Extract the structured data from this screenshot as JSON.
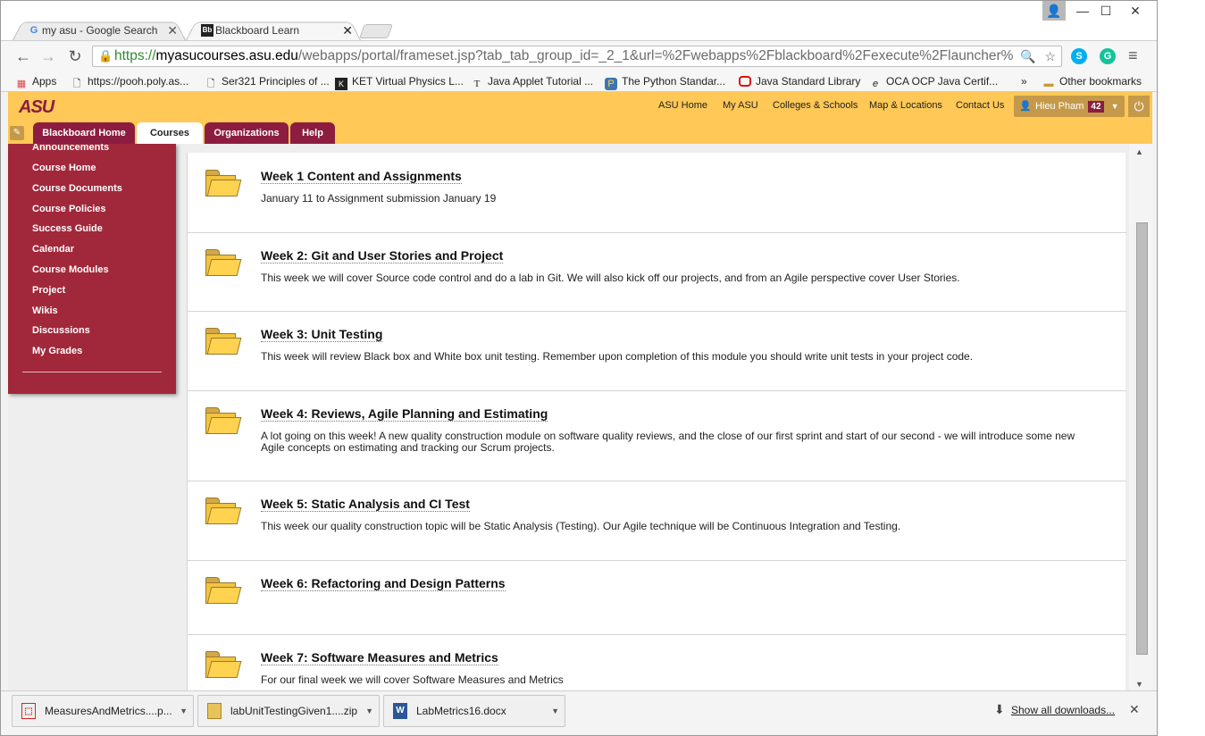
{
  "browser": {
    "tabs": [
      {
        "label": "my asu - Google Search",
        "favicon": "google-icon"
      },
      {
        "label": "Blackboard Learn",
        "favicon": "blackboard-icon"
      }
    ],
    "url_scheme": "https://",
    "url_host": "myasucourses.asu.edu",
    "url_path": "/webapps/portal/frameset.jsp?tab_tab_group_id=_2_1&url=%2Fwebapps%2Fblackboard%2Fexecute%2Flauncher%",
    "bookmarks": [
      {
        "label": "Apps",
        "icon": "apps-grid-icon"
      },
      {
        "label": "https://pooh.poly.as...",
        "icon": "page-icon"
      },
      {
        "label": "Ser321 Principles of ...",
        "icon": "page-icon"
      },
      {
        "label": "KET Virtual Physics L...",
        "icon": "ket-icon"
      },
      {
        "label": "Java Applet Tutorial ...",
        "icon": "text-t-icon"
      },
      {
        "label": "The Python Standar...",
        "icon": "python-icon"
      },
      {
        "label": "Java Standard Library",
        "icon": "oracle-icon"
      },
      {
        "label": "OCA OCP Java Certif...",
        "icon": "e-icon"
      }
    ],
    "other_bookmarks": "Other bookmarks",
    "overflow": "»"
  },
  "header": {
    "logo": "ASU",
    "top_links": [
      "ASU Home",
      "My ASU",
      "Colleges & Schools",
      "Map & Locations",
      "Contact Us"
    ],
    "user_name": "Hieu Pham",
    "notification_count": "42",
    "tabs": [
      "Blackboard Home",
      "Courses",
      "Organizations",
      "Help"
    ]
  },
  "course_menu": {
    "items": [
      "Announcements",
      "Course Home",
      "Course Documents",
      "Course Policies",
      "Success Guide",
      "Calendar",
      "Course Modules",
      "Project",
      "Wikis",
      "Discussions",
      "My Grades"
    ]
  },
  "content": {
    "items": [
      {
        "title": "Week 1 Content and Assignments",
        "description": "January 11 to Assignment submission January 19"
      },
      {
        "title": "Week 2: Git and User Stories and Project",
        "description": "This week we will cover Source code control and do a lab in Git. We will also kick off our projects, and from an Agile perspective cover User Stories."
      },
      {
        "title": "Week 3: Unit Testing",
        "description": "This week will review Black box and White box unit testing. Remember upon completion of this module you should write unit tests in your project code."
      },
      {
        "title": "Week 4: Reviews, Agile Planning and Estimating",
        "description": "A lot going on this week! A new quality construction module on software quality reviews, and the close of our first sprint and start of our second - we will introduce some new Agile concepts on estimating and tracking our Scrum projects."
      },
      {
        "title": "Week 5: Static Analysis and CI Test",
        "description": "This week our quality construction topic will be Static Analysis (Testing). Our Agile technique will be Continuous Integration and Testing."
      },
      {
        "title": "Week 6: Refactoring and Design Patterns",
        "description": ""
      },
      {
        "title": "Week 7: Software Measures and Metrics",
        "description": "For our final week we will cover Software Measures and Metrics"
      }
    ]
  },
  "downloads": {
    "files": [
      {
        "name": "MeasuresAndMetrics....p...",
        "icon": "pdf-icon"
      },
      {
        "name": "labUnitTestingGiven1....zip",
        "icon": "zip-icon"
      },
      {
        "name": "LabMetrics16.docx",
        "icon": "word-icon"
      }
    ],
    "show_all": "Show all downloads..."
  }
}
